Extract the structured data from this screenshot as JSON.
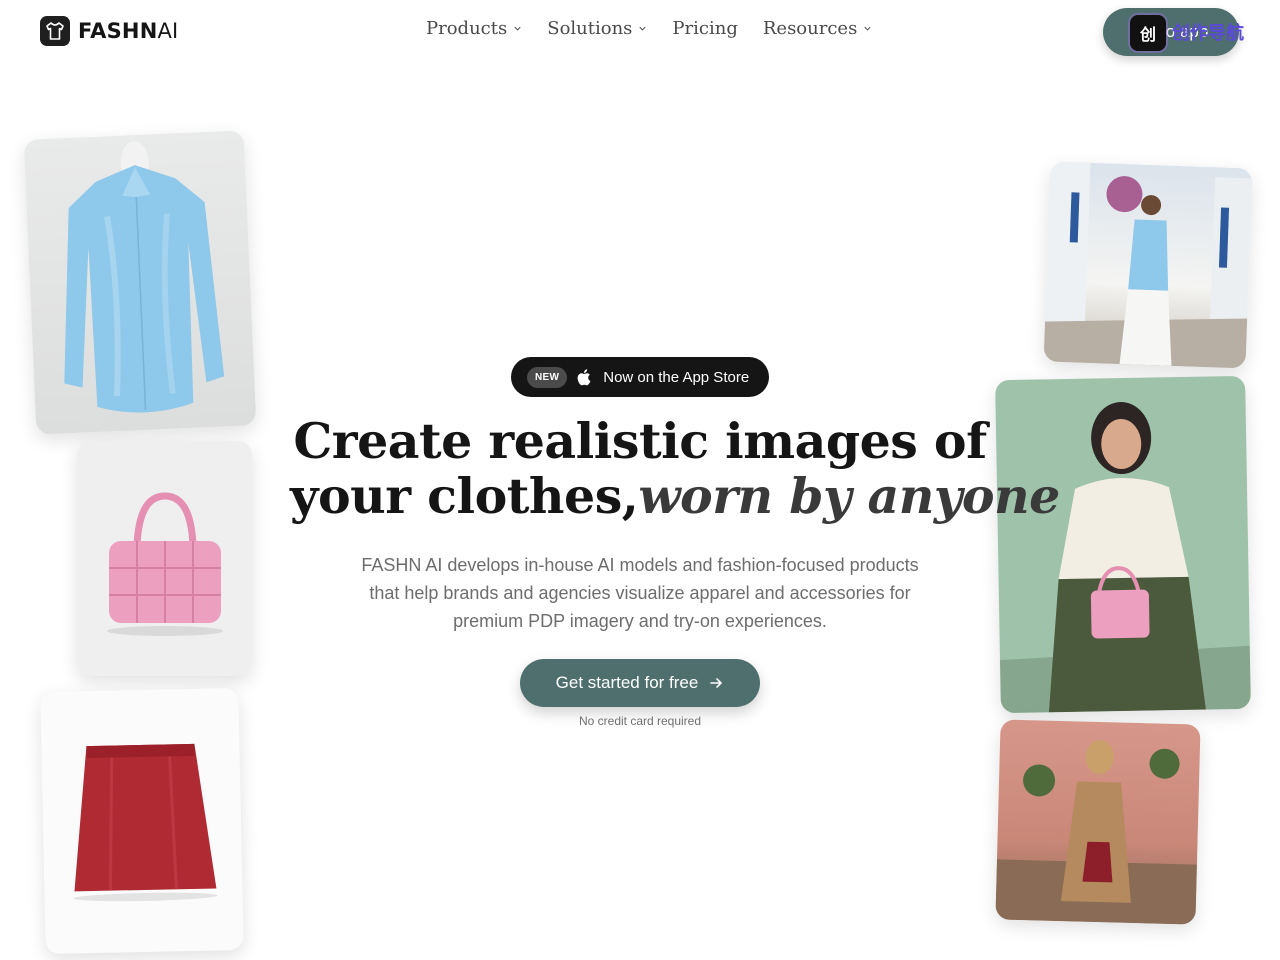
{
  "brand": {
    "name_bold": "FASHN",
    "name_light": "AI",
    "logo_icon": "tshirt-icon"
  },
  "nav": {
    "items": [
      {
        "label": "Products",
        "has_dropdown": true
      },
      {
        "label": "Solutions",
        "has_dropdown": true
      },
      {
        "label": "Pricing",
        "has_dropdown": false
      },
      {
        "label": "Resources",
        "has_dropdown": true
      }
    ]
  },
  "header_button": {
    "label": "Go to app"
  },
  "watermark": {
    "icon_glyph": "创",
    "text": "创作导航"
  },
  "hero": {
    "badge": "NEW",
    "announcement": "Now on the App Store",
    "title_line1": "Create realistic images of",
    "title_line2_plain": "your clothes,",
    "title_line2_italic": "worn by anyone",
    "subtitle": "FASHN AI develops in-house AI models and fashion-focused products that help brands and agencies visualize apparel and accessories for premium PDP imagery and try-on experiences.",
    "cta_label": "Get started for free",
    "cta_note": "No credit card required"
  },
  "colors": {
    "accent": "#4e6f6d",
    "pill_bg": "#151515",
    "blouse": "#8ec8ea",
    "bag": "#ec9fbf",
    "skirt": "#b02a34",
    "green_bg": "#9fc3aa"
  }
}
